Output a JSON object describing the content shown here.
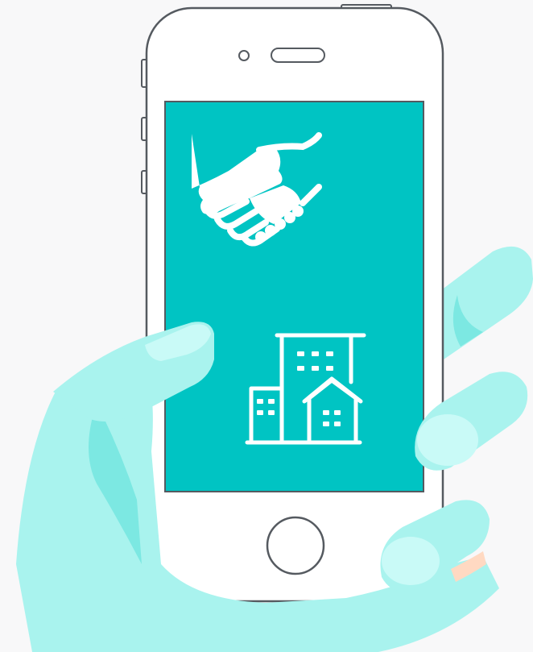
{
  "colors": {
    "background": "#f8f8f9",
    "phone_body": "#ffffff",
    "phone_outline": "#555a60",
    "screen": "#00c4c3",
    "icon": "#ffffff",
    "hand_light": "#a9f3ee",
    "hand_mid": "#7ce8e2",
    "hand_highlight": "#c9faf7",
    "palm_shadow": "#ffd9c2"
  },
  "screen_icons": [
    "handshake-icon",
    "office-building-icon"
  ]
}
